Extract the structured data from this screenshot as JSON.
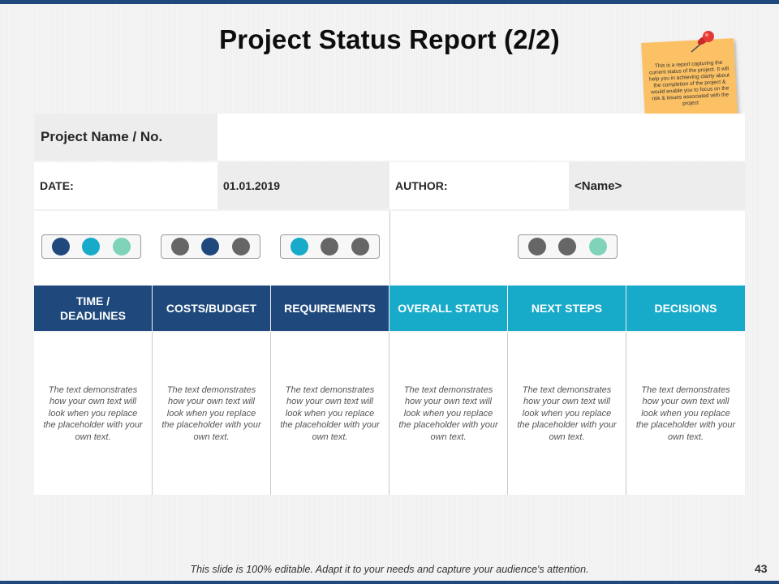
{
  "title": "Project Status Report (2/2)",
  "note": {
    "text": "This is a report capturing the current status of the project. It will help you in achieving clarity about the completion of the project & would enable you to focus on the risk & issues associated with the project",
    "color": "#fbc164"
  },
  "project_name_label": "Project Name / No.",
  "project_name_value": "",
  "date_label": "DATE:",
  "date_value": "01.01.2019",
  "author_label": "AUTHOR:",
  "author_value": "<Name>",
  "traffic_lights": [
    {
      "dots": [
        "#1f497d",
        "#17aac9",
        "#7fd3b8"
      ]
    },
    {
      "dots": [
        "#666666",
        "#1f497d",
        "#666666"
      ]
    },
    {
      "dots": [
        "#17aac9",
        "#666666",
        "#666666"
      ]
    },
    {
      "dots": [
        "#666666",
        "#666666",
        "#7fd3b8"
      ]
    }
  ],
  "columns": [
    {
      "header": "TIME / DEADLINES",
      "body": "The text demonstrates how your own text will look when you replace the placeholder with your own text."
    },
    {
      "header": "COSTS/BUDGET",
      "body": "The text demonstrates how your own text will look when you replace the placeholder with your own text."
    },
    {
      "header": "REQUIREMENTS",
      "body": "The text demonstrates how your own text will look when you replace the placeholder with your own text."
    },
    {
      "header": "OVERALL STATUS",
      "body": "The text demonstrates how your own text will look when you replace the placeholder with your own text."
    },
    {
      "header": "NEXT STEPS",
      "body": "The text demonstrates how your own text will look when you replace the placeholder with your own text."
    },
    {
      "header": "DECISIONS",
      "body": "The text demonstrates how your own text will look when you replace the placeholder with your own text."
    }
  ],
  "colors": {
    "dark_blue": "#1f497d",
    "light_blue": "#17aac9"
  },
  "footer": "This slide is 100% editable. Adapt it to your needs and capture your audience's  attention.",
  "page_number": "43"
}
